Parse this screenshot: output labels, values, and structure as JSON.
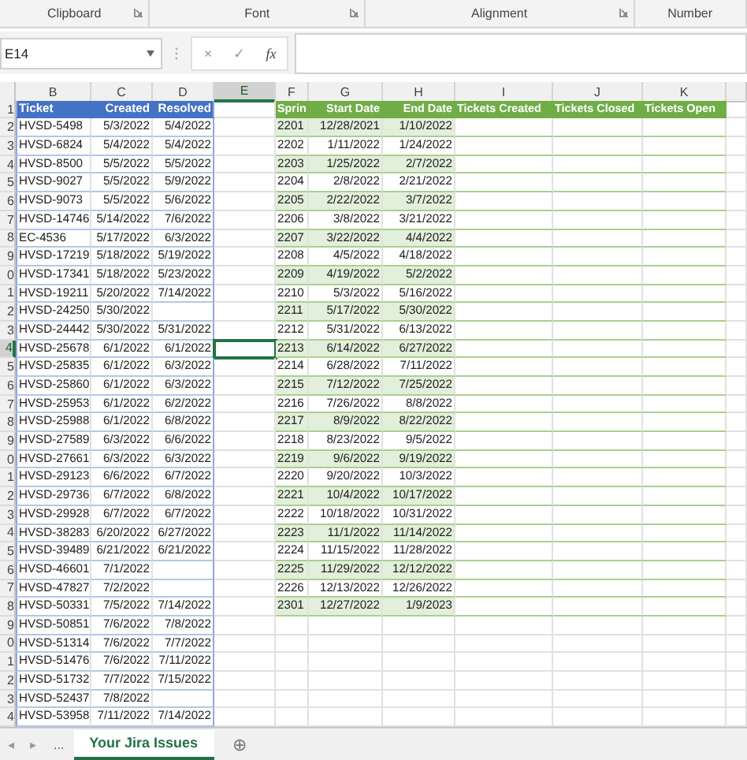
{
  "ribbon_groups": [
    {
      "label": "Clipboard",
      "launcher": true
    },
    {
      "label": "Font",
      "launcher": true
    },
    {
      "label": "Alignment",
      "launcher": true
    },
    {
      "label": "Number",
      "launcher": false
    }
  ],
  "formula_bar": {
    "name_box": "E14",
    "buttons": [
      "×",
      "✓",
      "fx"
    ]
  },
  "column_headers": [
    {
      "label": "B",
      "selected": false
    },
    {
      "label": "C",
      "selected": false
    },
    {
      "label": "D",
      "selected": false
    },
    {
      "label": "E",
      "selected": true
    },
    {
      "label": "F",
      "selected": false
    },
    {
      "label": "G",
      "selected": false
    },
    {
      "label": "H",
      "selected": false
    },
    {
      "label": "I",
      "selected": false
    },
    {
      "label": "J",
      "selected": false
    },
    {
      "label": "K",
      "selected": false
    }
  ],
  "row_headers": [
    {
      "label": "1",
      "selected": false
    },
    {
      "label": "2",
      "selected": false
    },
    {
      "label": "3",
      "selected": false
    },
    {
      "label": "4",
      "selected": false
    },
    {
      "label": "5",
      "selected": false
    },
    {
      "label": "6",
      "selected": false
    },
    {
      "label": "7",
      "selected": false
    },
    {
      "label": "8",
      "selected": false
    },
    {
      "label": "9",
      "selected": false
    },
    {
      "label": "0",
      "selected": false
    },
    {
      "label": "1",
      "selected": false
    },
    {
      "label": "2",
      "selected": false
    },
    {
      "label": "3",
      "selected": false
    },
    {
      "label": "4",
      "selected": true
    },
    {
      "label": "5",
      "selected": false
    },
    {
      "label": "6",
      "selected": false
    },
    {
      "label": "7",
      "selected": false
    },
    {
      "label": "8",
      "selected": false
    },
    {
      "label": "9",
      "selected": false
    },
    {
      "label": "0",
      "selected": false
    },
    {
      "label": "1",
      "selected": false
    },
    {
      "label": "2",
      "selected": false
    },
    {
      "label": "3",
      "selected": false
    },
    {
      "label": "4",
      "selected": false
    },
    {
      "label": "5",
      "selected": false
    },
    {
      "label": "6",
      "selected": false
    },
    {
      "label": "7",
      "selected": false
    },
    {
      "label": "8",
      "selected": false
    },
    {
      "label": "9",
      "selected": false
    },
    {
      "label": "0",
      "selected": false
    },
    {
      "label": "1",
      "selected": false
    },
    {
      "label": "2",
      "selected": false
    },
    {
      "label": "3",
      "selected": false
    },
    {
      "label": "4",
      "selected": false
    }
  ],
  "tickets_table": {
    "columns": [
      "Ticket",
      "Created",
      "Resolved"
    ],
    "rows": [
      [
        "HVSD-5498",
        "5/3/2022",
        "5/4/2022"
      ],
      [
        "HVSD-6824",
        "5/4/2022",
        "5/4/2022"
      ],
      [
        "HVSD-8500",
        "5/5/2022",
        "5/5/2022"
      ],
      [
        "HVSD-9027",
        "5/5/2022",
        "5/9/2022"
      ],
      [
        "HVSD-9073",
        "5/5/2022",
        "5/6/2022"
      ],
      [
        "HVSD-14746",
        "5/14/2022",
        "7/6/2022"
      ],
      [
        "EC-4536",
        "5/17/2022",
        "6/3/2022"
      ],
      [
        "HVSD-17219",
        "5/18/2022",
        "5/19/2022"
      ],
      [
        "HVSD-17341",
        "5/18/2022",
        "5/23/2022"
      ],
      [
        "HVSD-19211",
        "5/20/2022",
        "7/14/2022"
      ],
      [
        "HVSD-24250",
        "5/30/2022",
        ""
      ],
      [
        "HVSD-24442",
        "5/30/2022",
        "5/31/2022"
      ],
      [
        "HVSD-25678",
        "6/1/2022",
        "6/1/2022"
      ],
      [
        "HVSD-25835",
        "6/1/2022",
        "6/3/2022"
      ],
      [
        "HVSD-25860",
        "6/1/2022",
        "6/3/2022"
      ],
      [
        "HVSD-25953",
        "6/1/2022",
        "6/2/2022"
      ],
      [
        "HVSD-25988",
        "6/1/2022",
        "6/8/2022"
      ],
      [
        "HVSD-27589",
        "6/3/2022",
        "6/6/2022"
      ],
      [
        "HVSD-27661",
        "6/3/2022",
        "6/3/2022"
      ],
      [
        "HVSD-29123",
        "6/6/2022",
        "6/7/2022"
      ],
      [
        "HVSD-29736",
        "6/7/2022",
        "6/8/2022"
      ],
      [
        "HVSD-29928",
        "6/7/2022",
        "6/7/2022"
      ],
      [
        "HVSD-38283",
        "6/20/2022",
        "6/27/2022"
      ],
      [
        "HVSD-39489",
        "6/21/2022",
        "6/21/2022"
      ],
      [
        "HVSD-46601",
        "7/1/2022",
        ""
      ],
      [
        "HVSD-47827",
        "7/2/2022",
        ""
      ],
      [
        "HVSD-50331",
        "7/5/2022",
        "7/14/2022"
      ],
      [
        "HVSD-50851",
        "7/6/2022",
        "7/8/2022"
      ],
      [
        "HVSD-51314",
        "7/6/2022",
        "7/7/2022"
      ],
      [
        "HVSD-51476",
        "7/6/2022",
        "7/11/2022"
      ],
      [
        "HVSD-51732",
        "7/7/2022",
        "7/15/2022"
      ],
      [
        "HVSD-52437",
        "7/8/2022",
        ""
      ],
      [
        "HVSD-53958",
        "7/11/2022",
        "7/14/2022"
      ]
    ]
  },
  "sprints_table": {
    "columns": [
      "Sprin",
      "Start Date",
      "End Date",
      "Tickets Created",
      "Tickets Closed",
      "Tickets Open"
    ],
    "rows": [
      [
        "2201",
        "12/28/2021",
        "1/10/2022"
      ],
      [
        "2202",
        "1/11/2022",
        "1/24/2022"
      ],
      [
        "2203",
        "1/25/2022",
        "2/7/2022"
      ],
      [
        "2204",
        "2/8/2022",
        "2/21/2022"
      ],
      [
        "2205",
        "2/22/2022",
        "3/7/2022"
      ],
      [
        "2206",
        "3/8/2022",
        "3/21/2022"
      ],
      [
        "2207",
        "3/22/2022",
        "4/4/2022"
      ],
      [
        "2208",
        "4/5/2022",
        "4/18/2022"
      ],
      [
        "2209",
        "4/19/2022",
        "5/2/2022"
      ],
      [
        "2210",
        "5/3/2022",
        "5/16/2022"
      ],
      [
        "2211",
        "5/17/2022",
        "5/30/2022"
      ],
      [
        "2212",
        "5/31/2022",
        "6/13/2022"
      ],
      [
        "2213",
        "6/14/2022",
        "6/27/2022"
      ],
      [
        "2214",
        "6/28/2022",
        "7/11/2022"
      ],
      [
        "2215",
        "7/12/2022",
        "7/25/2022"
      ],
      [
        "2216",
        "7/26/2022",
        "8/8/2022"
      ],
      [
        "2217",
        "8/9/2022",
        "8/22/2022"
      ],
      [
        "2218",
        "8/23/2022",
        "9/5/2022"
      ],
      [
        "2219",
        "9/6/2022",
        "9/19/2022"
      ],
      [
        "2220",
        "9/20/2022",
        "10/3/2022"
      ],
      [
        "2221",
        "10/4/2022",
        "10/17/2022"
      ],
      [
        "2222",
        "10/18/2022",
        "10/31/2022"
      ],
      [
        "2223",
        "11/1/2022",
        "11/14/2022"
      ],
      [
        "2224",
        "11/15/2022",
        "11/28/2022"
      ],
      [
        "2225",
        "11/29/2022",
        "12/12/2022"
      ],
      [
        "2226",
        "12/13/2022",
        "12/26/2022"
      ],
      [
        "2301",
        "12/27/2022",
        "1/9/2023"
      ]
    ]
  },
  "sheet_bar": {
    "nav": [
      "◂",
      "▸"
    ],
    "overflow": "...",
    "tabs": [
      {
        "label": "Your Jira Issues",
        "selected": true
      }
    ],
    "add": "⊕"
  }
}
